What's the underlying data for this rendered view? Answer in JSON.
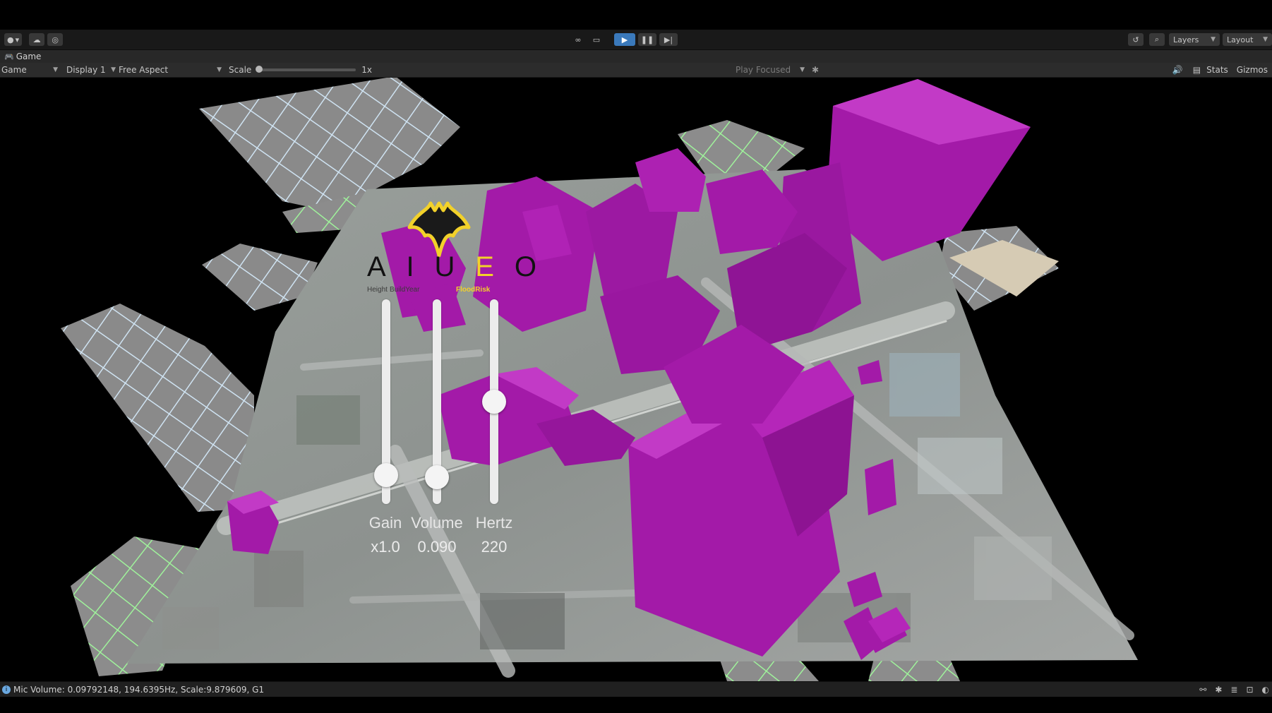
{
  "toolbar": {
    "account_label": "",
    "play_mode": "play",
    "layers_label": "Layers",
    "layout_label": "Layout"
  },
  "tabs": {
    "game_tab_label": "Game"
  },
  "gamebar": {
    "view_label": "Game",
    "display_label": "Display 1",
    "aspect_label": "Free Aspect",
    "scale_label": "Scale",
    "scale_value": "1x",
    "play_focused_label": "Play Focused",
    "stats_label": "Stats",
    "gizmos_label": "Gizmos"
  },
  "overlay": {
    "vowels": [
      "A",
      "I",
      "U",
      "E",
      "O"
    ],
    "active_vowel_index": 3,
    "captions": [
      "Height",
      "BuildYear",
      "",
      "FloodRisk",
      ""
    ],
    "sliders": [
      {
        "label": "Gain",
        "value_text": "x1.0",
        "level": 0.14
      },
      {
        "label": "Volume",
        "value_text": "0.090",
        "level": 0.13
      },
      {
        "label": "Hertz",
        "value_text": "220",
        "level": 0.5
      }
    ]
  },
  "status": {
    "message": "Mic Volume: 0.09792148, 194.6395Hz, Scale:9.879609, G1"
  },
  "colors": {
    "building": "#a31aa8",
    "accent": "#f2d12a",
    "play_blue": "#3a79bb"
  }
}
